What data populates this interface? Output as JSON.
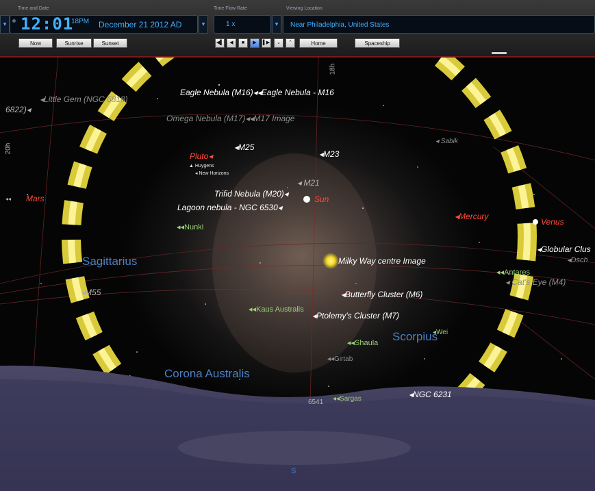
{
  "toolbar": {
    "time_date_label": "Time and Date",
    "time": "12:01",
    "ampm": "18PM",
    "date": "December 21   2012 AD",
    "flow_label": "Time Flow Rate",
    "flow_rate": "1 x",
    "location_label": "Viewing Location",
    "location": "Near Philadelphia, United States",
    "buttons": {
      "now": "Now",
      "sunrise": "Sunrise",
      "sunset": "Sunset",
      "home": "Home",
      "spaceship": "Spaceship"
    },
    "transport": {
      "skip_back": "◀▌",
      "back": "◀",
      "stop": "■",
      "play": "▶",
      "skip_fwd": "▌▶",
      "down": "⌄",
      "up": "⌃"
    }
  },
  "sky": {
    "ra_label_top": "18h",
    "ra_label_left": "20h",
    "compass": "S",
    "objects": {
      "little_gem": "◂Little Gem (NGC 6818)",
      "ngc6822": "6822)◂",
      "eagle": "Eagle Nebula (M16)◂◂Eagle Nebula - M16",
      "omega": "Omega Nebula (M17)◂◂M17 Image",
      "m25": "◂M25",
      "m23": "◂M23",
      "pluto": "Pluto◂",
      "huygens": "▲ Huygens",
      "new_horizons": "◂ New Horizons",
      "m21": "◂ M21",
      "trifid": "Trifid Nebula (M20)◂",
      "sun": "Sun",
      "lagoon": "Lagoon nebula - NGC 6530◂",
      "mars": "Mars",
      "mars_prefix": "◂◂",
      "sabik": "◂ Sabik",
      "mercury": "◂Mercury",
      "venus": "Venus",
      "nunki": "◂◂Nunki",
      "milky": "Milky Way centre Image",
      "globular": "◂Globular Clus",
      "dsch": "◂Dsch",
      "antares": "◂◂Antares",
      "cats_eye": "◂ Cat's Eye (M4)",
      "m55": "◂M55",
      "butterfly": "◂Butterfly Cluster (M6)",
      "kaus": "◂◂Kaus Australis",
      "ptolemy": "◂Ptolemy's Cluster (M7)",
      "wei": "◂Wei",
      "shaula": "◂◂Shaula",
      "girtab": "◂◂Girtab",
      "sargas": "◂◂Sargas",
      "ngc6541": "6541",
      "ngc6231": "◂NGC 6231"
    },
    "constellations": {
      "sagittarius": "Sagittarius",
      "scorpius": "Scorpius",
      "corona_australis": "Corona Australis"
    }
  },
  "colors": {
    "accent": "#3fb0ff",
    "planet": "#ff4a3a",
    "star": "#9bd07a",
    "constellation": "#4d7fc4",
    "sun_glow": "#ffee33"
  }
}
